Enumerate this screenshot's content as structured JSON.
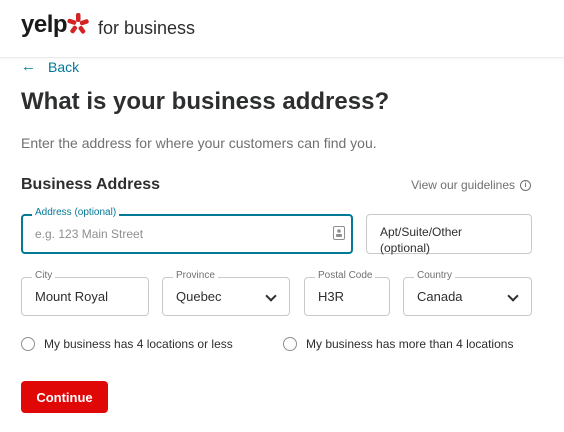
{
  "header": {
    "logo_text": "yelp",
    "subtitle": "for business",
    "brand_color": "#d32323"
  },
  "back": {
    "icon": "arrow-left-icon",
    "label": "Back"
  },
  "page": {
    "title": "What is your business address?",
    "subtitle": "Enter the address for where your customers can find you."
  },
  "section": {
    "title": "Business Address",
    "guidelines_link": "View our guidelines",
    "guidelines_icon": "info-icon"
  },
  "form": {
    "address": {
      "label": "Address (optional)",
      "placeholder": "e.g. 123 Main Street"
    },
    "apt": {
      "placeholder": "Apt/Suite/Other (optional)"
    },
    "city": {
      "label": "City",
      "value": "Mount Royal"
    },
    "province": {
      "label": "Province",
      "value": "Quebec"
    },
    "postal": {
      "label": "Postal Code",
      "value": "H3R"
    },
    "country": {
      "label": "Country",
      "value": "Canada"
    }
  },
  "locations": {
    "option_few": "My business has 4 locations or less",
    "option_many": "My business has more than 4 locations"
  },
  "actions": {
    "continue_label": "Continue",
    "continue_color": "#e00707"
  },
  "colors": {
    "accent": "#027a97",
    "text": "#2d2e2f",
    "muted": "#6e7072"
  }
}
